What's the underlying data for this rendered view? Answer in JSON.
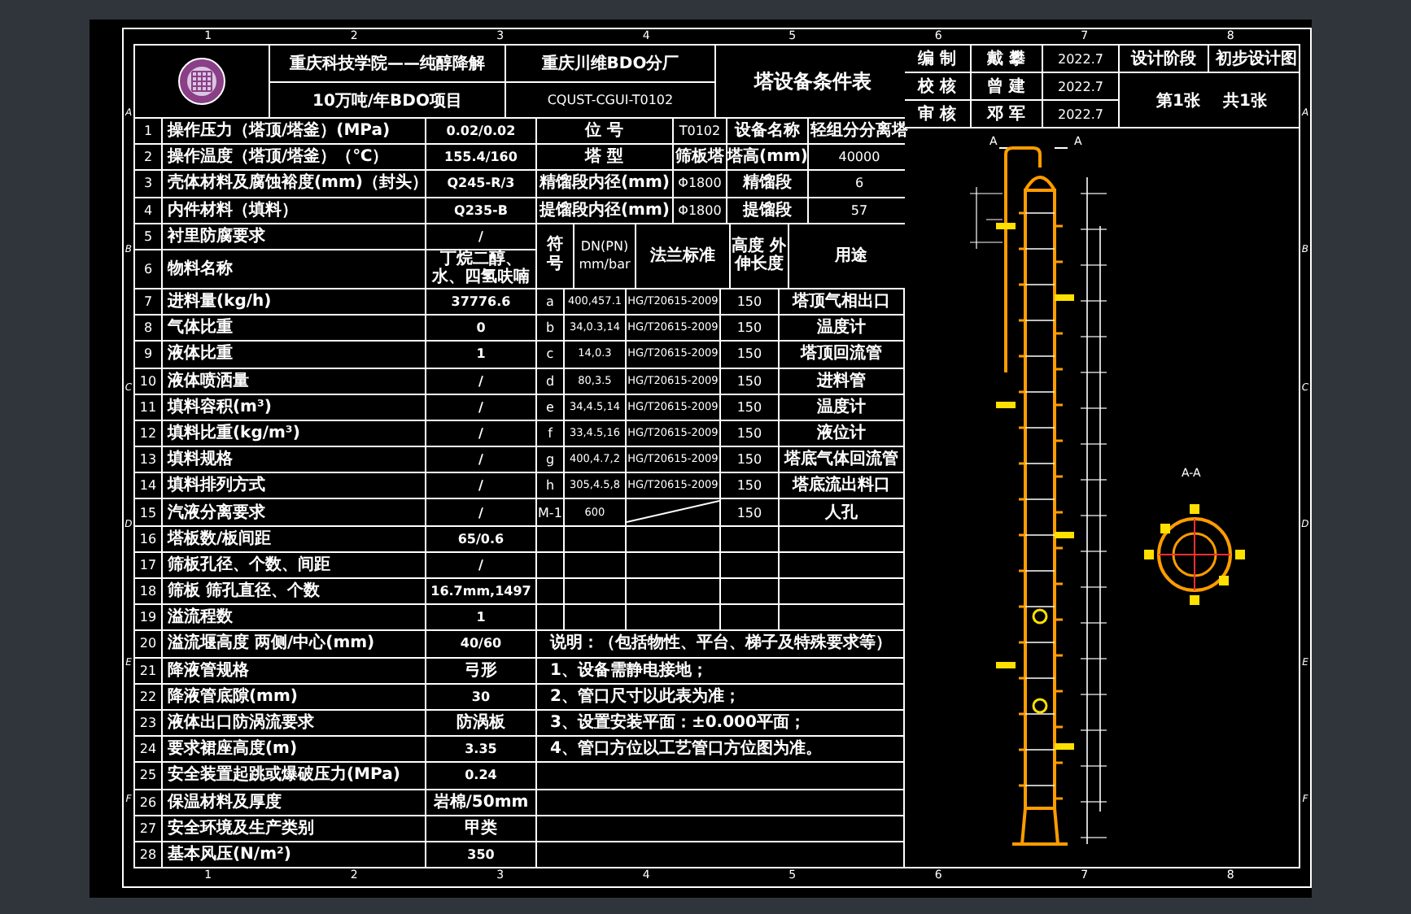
{
  "sheet": {
    "top_marks": [
      "1",
      "2",
      "3",
      "4",
      "5",
      "6",
      "7",
      "8"
    ],
    "bottom_marks": [
      "1",
      "2",
      "3",
      "4",
      "5",
      "6",
      "7",
      "8"
    ],
    "left_marks": [
      "A",
      "B",
      "C",
      "D",
      "E",
      "F"
    ],
    "right_marks": [
      "A",
      "B",
      "C",
      "D",
      "E",
      "F"
    ]
  },
  "header": {
    "school": "重庆科技学院——纯醇降解",
    "project": "10万吨/年BDO项目",
    "company": "重庆川维BDO分厂",
    "drawing_no": "CQUST-CGUI-T0102",
    "title": "塔设备条件表"
  },
  "title_block": {
    "rows": [
      {
        "role": "编 制",
        "name": "戴 攀",
        "date": "2022.7"
      },
      {
        "role": "校 核",
        "name": "曾 建",
        "date": "2022.7"
      },
      {
        "role": "审 核",
        "name": "邓 军",
        "date": "2022.7"
      }
    ],
    "stage_label": "设计阶段",
    "stage": "初步设计图",
    "sheet_no": "第1张",
    "sheet_total": "共1张"
  },
  "parameters": [
    {
      "no": "1",
      "label": "操作压力（塔顶/塔釜）(MPa)",
      "value": "0.02/0.02"
    },
    {
      "no": "2",
      "label": "操作温度（塔顶/塔釜）（℃）",
      "value": "155.4/160"
    },
    {
      "no": "3",
      "label": "壳体材料及腐蚀裕度(mm)（封头）",
      "value": "Q245-R/3"
    },
    {
      "no": "4",
      "label": "内件材料（填料）",
      "value": "Q235-B"
    },
    {
      "no": "5",
      "label": "衬里防腐要求",
      "value": "/"
    },
    {
      "no": "6",
      "label": "物料名称",
      "value": "丁烷二醇、水、四氢呋喃"
    },
    {
      "no": "7",
      "label": "进料量(kg/h)",
      "value": "37776.6"
    },
    {
      "no": "8",
      "label": "气体比重",
      "value": "0"
    },
    {
      "no": "9",
      "label": "液体比重",
      "value": "1"
    },
    {
      "no": "10",
      "label": "液体喷洒量",
      "value": "/"
    },
    {
      "no": "11",
      "label": "填料容积(m³)",
      "value": "/"
    },
    {
      "no": "12",
      "label": "填料比重(kg/m³)",
      "value": "/"
    },
    {
      "no": "13",
      "label": "填料规格",
      "value": "/"
    },
    {
      "no": "14",
      "label": "填料排列方式",
      "value": "/"
    },
    {
      "no": "15",
      "label": "汽液分离要求",
      "value": "/"
    },
    {
      "no": "16",
      "label": "塔板数/板间距",
      "value": "65/0.6"
    },
    {
      "no": "17",
      "label": "筛板孔径、个数、间距",
      "value": "/"
    },
    {
      "no": "18",
      "label": "筛板 筛孔直径、个数",
      "value": "16.7mm,1497"
    },
    {
      "no": "19",
      "label": "溢流程数",
      "value": "1"
    },
    {
      "no": "20",
      "label": "溢流堰高度 两侧/中心(mm)",
      "value": "40/60"
    },
    {
      "no": "21",
      "label": "降液管规格",
      "value": "弓形"
    },
    {
      "no": "22",
      "label": "降液管底隙(mm)",
      "value": "30"
    },
    {
      "no": "23",
      "label": "液体出口防涡流要求",
      "value": "防涡板"
    },
    {
      "no": "24",
      "label": "要求裙座高度(m)",
      "value": "3.35"
    },
    {
      "no": "25",
      "label": "安全装置起跳或爆破压力(MPa)",
      "value": "0.24"
    },
    {
      "no": "26",
      "label": "保温材料及厚度",
      "value": "岩棉/50mm"
    },
    {
      "no": "27",
      "label": "安全环境及生产类别",
      "value": "甲类"
    },
    {
      "no": "28",
      "label": "基本风压(N/m²)",
      "value": "350"
    }
  ],
  "equipment_info": [
    {
      "label": "位 号",
      "value": "T0102",
      "label_2": "设备名称",
      "value_2": "轻组分分离塔"
    },
    {
      "label": "塔 型",
      "value": "筛板塔",
      "label_2": "塔高(mm)",
      "value_2": "40000"
    },
    {
      "label": "精馏段内径(mm)",
      "value": "Φ1800",
      "label_2": "精馏段",
      "value_2": "6"
    },
    {
      "label": "提馏段内径(mm)",
      "value": "Φ1800",
      "label_2": "提馏段",
      "value_2": "57"
    }
  ],
  "nozzle_table": {
    "columns": [
      "符号",
      "DN(PN) mm/bar",
      "法兰标准",
      "高度 外伸长度",
      "用途"
    ],
    "rows": [
      {
        "symbol": "a",
        "size": "400,457.1",
        "flange": "HG/T20615-2009",
        "length": "150",
        "purpose": "塔顶气相出口"
      },
      {
        "symbol": "b",
        "size": "34,0.3,14",
        "flange": "HG/T20615-2009",
        "length": "150",
        "purpose": "温度计"
      },
      {
        "symbol": "c",
        "size": "14,0.3",
        "flange": "HG/T20615-2009",
        "length": "150",
        "purpose": "塔顶回流管"
      },
      {
        "symbol": "d",
        "size": "80,3.5",
        "flange": "HG/T20615-2009",
        "length": "150",
        "purpose": "进料管"
      },
      {
        "symbol": "e",
        "size": "34,4.5,14",
        "flange": "HG/T20615-2009",
        "length": "150",
        "purpose": "温度计"
      },
      {
        "symbol": "f",
        "size": "33,4.5,16",
        "flange": "HG/T20615-2009",
        "length": "150",
        "purpose": "液位计"
      },
      {
        "symbol": "g",
        "size": "400,4.7,2",
        "flange": "HG/T20615-2009",
        "length": "150",
        "purpose": "塔底气体回流管"
      },
      {
        "symbol": "h",
        "size": "305,4.5,8",
        "flange": "HG/T20615-2009",
        "length": "150",
        "purpose": "塔底流出料口"
      },
      {
        "symbol": "M-1",
        "size": "600",
        "length": "150",
        "purpose": "人孔"
      }
    ]
  },
  "notes": [
    "说明：（包括物性、平台、梯子及特殊要求等）",
    "1、设备需静电接地；",
    "2、管口尺寸以此表为准；",
    "3、设置安装平面：±0.000平面；",
    "4、管口方位以工艺管口方位图为准。"
  ],
  "drawing": {
    "cut_marks": [
      "A",
      "A"
    ],
    "section_label": "A-A"
  }
}
